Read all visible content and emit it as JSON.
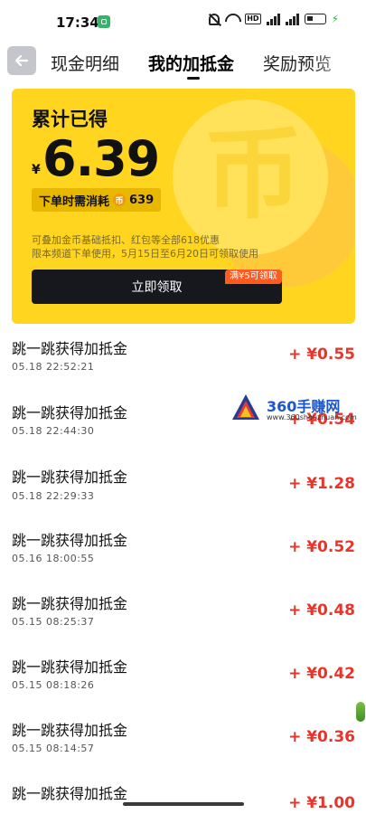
{
  "status_bar": {
    "time": "17:34",
    "hd_label": "HD",
    "charging": "⚡"
  },
  "tabs": [
    {
      "label": "现金明细",
      "active": false
    },
    {
      "label": "我的加抵金",
      "active": true
    },
    {
      "label": "奖励预览",
      "active": false
    }
  ],
  "card": {
    "title": "累计已得",
    "currency": "¥",
    "amount": "6.39",
    "coin_glyph": "币",
    "consume_label": "下单时需消耗",
    "coin_badge_text": "币",
    "consume_count": "639",
    "rules_line1": "可叠加金币基础抵扣、红包等全部618优惠",
    "rules_line2": "限本频道下单使用，5月15日至6月20日可领取使用",
    "claim_button": "立即领取",
    "claim_tag": "满¥5可领取",
    "accent": "#ffd51f"
  },
  "records": [
    {
      "title": "跳一跳获得加抵金",
      "time": "05.18 22:52:21",
      "amount": "+ ¥0.55"
    },
    {
      "title": "跳一跳获得加抵金",
      "time": "05.18 22:44:30",
      "amount": "+ ¥0.54"
    },
    {
      "title": "跳一跳获得加抵金",
      "time": "05.18 22:29:33",
      "amount": "+ ¥1.28"
    },
    {
      "title": "跳一跳获得加抵金",
      "time": "05.16 18:00:55",
      "amount": "+ ¥0.52"
    },
    {
      "title": "跳一跳获得加抵金",
      "time": "05.15 08:25:37",
      "amount": "+ ¥0.48"
    },
    {
      "title": "跳一跳获得加抵金",
      "time": "05.15 08:18:26",
      "amount": "+ ¥0.42"
    },
    {
      "title": "跳一跳获得加抵金",
      "time": "05.15 08:14:57",
      "amount": "+ ¥0.36"
    },
    {
      "title": "跳一跳获得加抵金",
      "time": "",
      "amount": "+ ¥1.00"
    }
  ],
  "watermark": {
    "name": "360手赚网",
    "url": "www.360shouzhuan.com"
  },
  "colors": {
    "amount_red": "#e8352b",
    "button_dark": "#16181d"
  }
}
